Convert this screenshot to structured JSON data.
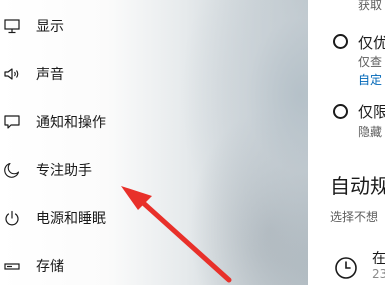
{
  "sidebar": {
    "items": [
      {
        "label": "显示",
        "icon": "monitor-icon"
      },
      {
        "label": "声音",
        "icon": "speaker-icon"
      },
      {
        "label": "通知和操作",
        "icon": "notification-icon"
      },
      {
        "label": "专注助手",
        "icon": "moon-icon"
      },
      {
        "label": "电源和睡眠",
        "icon": "power-icon"
      },
      {
        "label": "存储",
        "icon": "storage-icon"
      }
    ]
  },
  "content": {
    "top_partial_text": "获取",
    "options": [
      {
        "label": "仅优",
        "description": "仅查",
        "link": "自定"
      },
      {
        "label": "仅限",
        "description": "隐藏"
      }
    ],
    "auto_rules": {
      "heading": "自动规",
      "subtitle": "选择不想",
      "rule": {
        "title": "在",
        "subtitle": "23"
      }
    }
  },
  "colors": {
    "link": "#0067b8",
    "arrow": "#e8302a",
    "secondary_text": "#5d5d5d"
  }
}
